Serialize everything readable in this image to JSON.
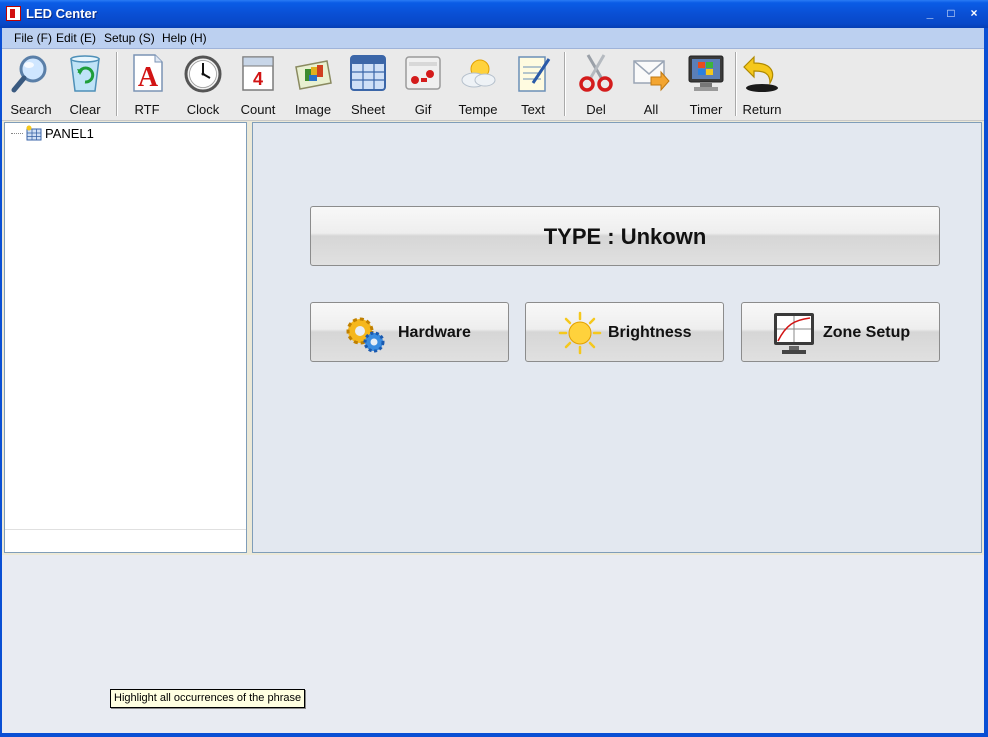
{
  "window": {
    "title": "LED Center",
    "controls": {
      "minimize": "_",
      "maximize": "□",
      "close": "×"
    }
  },
  "menu": [
    {
      "label": "File (F)"
    },
    {
      "label": "Edit (E)"
    },
    {
      "label": "Setup (S)"
    },
    {
      "label": "Help (H)"
    }
  ],
  "toolbar": {
    "items": [
      {
        "label": "Search",
        "icon": "magnifier-icon"
      },
      {
        "label": "Clear",
        "icon": "recycle-bin-icon"
      },
      {
        "label": "RTF",
        "icon": "rtf-document-icon"
      },
      {
        "label": "Clock",
        "icon": "clock-icon"
      },
      {
        "label": "Count",
        "icon": "calendar-icon"
      },
      {
        "label": "Image",
        "icon": "image-icon"
      },
      {
        "label": "Sheet",
        "icon": "sheet-icon"
      },
      {
        "label": "Gif",
        "icon": "gif-icon"
      },
      {
        "label": "Tempe",
        "icon": "weather-icon"
      },
      {
        "label": "Text",
        "icon": "notepad-icon"
      },
      {
        "label": "Del",
        "icon": "scissors-icon"
      },
      {
        "label": "All",
        "icon": "envelope-icon"
      },
      {
        "label": "Timer",
        "icon": "monitor-icon"
      },
      {
        "label": "Return",
        "icon": "return-arrow-icon"
      }
    ]
  },
  "tree": {
    "root_label": "PANEL1"
  },
  "main": {
    "type_label": "TYPE : Unkown",
    "hardware_label": "Hardware",
    "brightness_label": "Brightness",
    "zone_setup_label": "Zone Setup"
  },
  "tooltip": {
    "text": "Highlight all occurrences of the phrase"
  }
}
